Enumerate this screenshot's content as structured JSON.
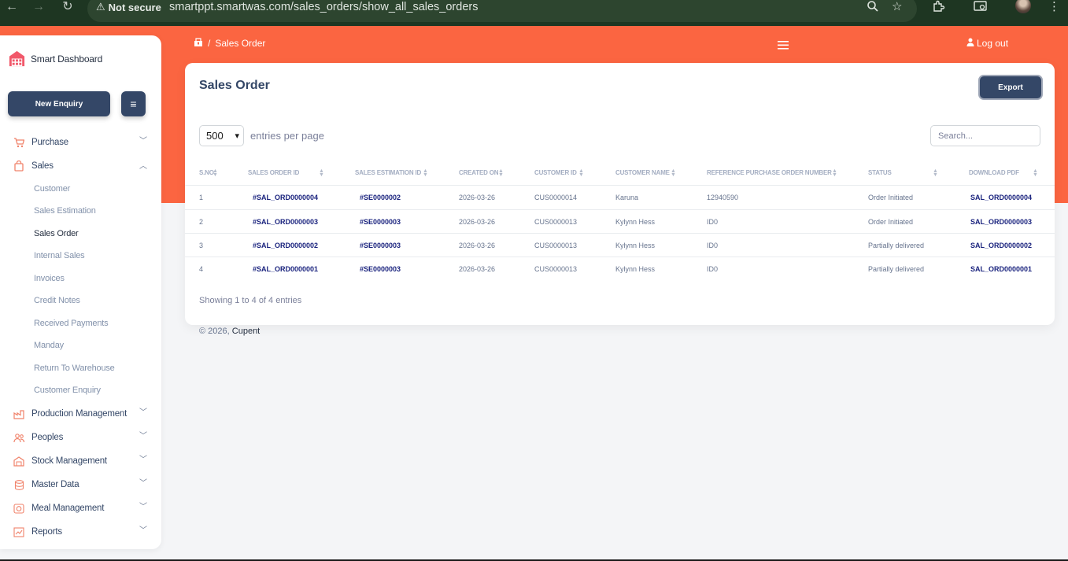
{
  "browser": {
    "security_label": "Not secure",
    "url": "smartppt.smartwas.com/sales_orders/show_all_sales_orders"
  },
  "brand": {
    "name": "Smart Dashboard"
  },
  "sidebar": {
    "new_enquiry": "New Enquiry",
    "items": [
      {
        "label": "Purchase",
        "icon": "cart-icon"
      },
      {
        "label": "Sales",
        "icon": "bag-icon"
      },
      {
        "label": "Production Management",
        "icon": "factory-icon"
      },
      {
        "label": "Peoples",
        "icon": "people-icon"
      },
      {
        "label": "Stock Management",
        "icon": "warehouse-icon"
      },
      {
        "label": "Master Data",
        "icon": "database-icon"
      },
      {
        "label": "Meal Management",
        "icon": "meal-icon"
      },
      {
        "label": "Reports",
        "icon": "report-icon"
      }
    ],
    "sales_sub": [
      "Customer",
      "Sales Estimation",
      "Sales Order",
      "Internal Sales",
      "Invoices",
      "Credit Notes",
      "Received Payments",
      "Manday",
      "Return To Warehouse",
      "Customer Enquiry"
    ]
  },
  "topbar": {
    "breadcrumb_sep": "/",
    "breadcrumb": "Sales Order",
    "logout": "Log out"
  },
  "page": {
    "title": "Sales Order",
    "export": "Export",
    "entries_value": "500",
    "entries_label": "entries per page",
    "search_placeholder": "Search...",
    "showing": "Showing 1 to 4 of 4 entries"
  },
  "table": {
    "headers": [
      "S.NO",
      "SALES ORDER ID",
      "SALES ESTIMATION ID",
      "CREATED ON",
      "CUSTOMER ID",
      "CUSTOMER NAME",
      "REFERENCE PURCHASE ORDER NUMBER",
      "STATUS",
      "DOWNLOAD PDF"
    ],
    "rows": [
      [
        "1",
        "#SAL_ORD0000004",
        "#SE0000002",
        "2026-03-26",
        "CUS0000014",
        "Karuna",
        "12940590",
        "Order Initiated",
        "SAL_ORD0000004"
      ],
      [
        "2",
        "#SAL_ORD0000003",
        "#SE0000003",
        "2026-03-26",
        "CUS0000013",
        "Kylynn Hess",
        "ID0",
        "Order Initiated",
        "SAL_ORD0000003"
      ],
      [
        "3",
        "#SAL_ORD0000002",
        "#SE0000003",
        "2026-03-26",
        "CUS0000013",
        "Kylynn Hess",
        "ID0",
        "Partially delivered",
        "SAL_ORD0000002"
      ],
      [
        "4",
        "#SAL_ORD0000001",
        "#SE0000003",
        "2026-03-26",
        "CUS0000013",
        "Kylynn Hess",
        "ID0",
        "Partially delivered",
        "SAL_ORD0000001"
      ]
    ]
  },
  "footer": {
    "copyright": "© 2026,",
    "company": "Cupent"
  },
  "colors": {
    "accent": "#fb6541",
    "primary": "#344767",
    "link": "#1a237e"
  }
}
